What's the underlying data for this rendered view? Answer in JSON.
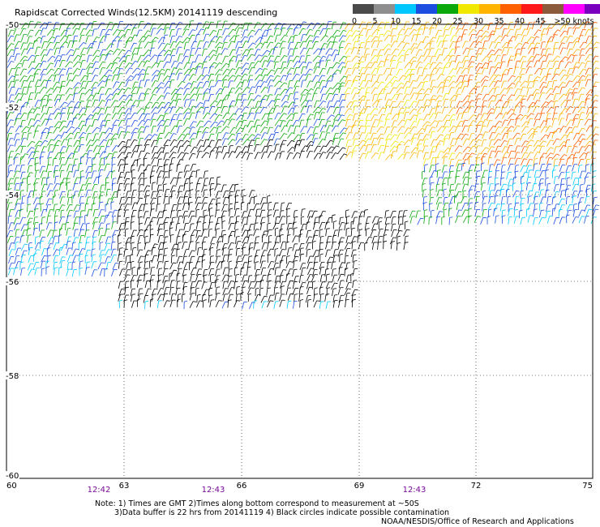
{
  "title": "Rapidscat Corrected Winds(12.5KM) 20141119 descending",
  "legend": {
    "labels": [
      "0",
      "5",
      "10",
      "15",
      "20",
      "25",
      "30",
      "35",
      "40",
      "45",
      ">50 knots"
    ],
    "colors": [
      "#4a4a4a",
      "#8e8e8e",
      "#00c8ff",
      "#1a4de0",
      "#0aa80a",
      "#f0e800",
      "#ffb400",
      "#ff6000",
      "#ff1a1a",
      "#8a5a3a",
      "#ff00ff",
      "#7a00c0"
    ]
  },
  "axes": {
    "lon_ticks": [
      "60",
      "63",
      "66",
      "69",
      "72",
      "75"
    ],
    "lat_ticks": [
      "-50",
      "-52",
      "-54",
      "-56",
      "-58",
      "-60"
    ]
  },
  "times": [
    "12:42",
    "12:43",
    "12:43"
  ],
  "notes": {
    "line1": "Note: 1) Times are GMT 2)Times along bottom correspond to measurement at ~50S",
    "line2": "3)Data buffer is 22 hrs from 20141119 4) Black circles indicate possible contamination",
    "line3": "NOAA/NESDIS/Office of Research and Applications"
  }
}
